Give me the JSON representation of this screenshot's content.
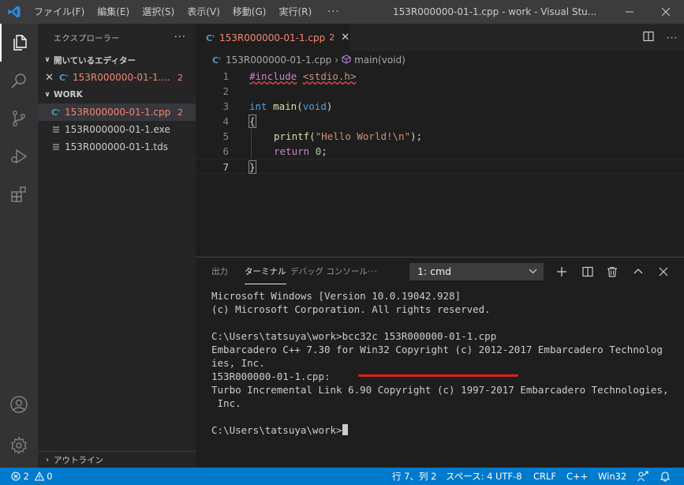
{
  "titlebar": {
    "menu": [
      "ファイル(F)",
      "編集(E)",
      "選択(S)",
      "表示(V)",
      "移動(G)",
      "実行(R)"
    ],
    "more": "···",
    "window_title": "153R000000-01-1.cpp - work - Visual Stu..."
  },
  "sidebar": {
    "title": "エクスプローラー",
    "more": "···",
    "open_editors": {
      "header": "開いているエディター",
      "items": [
        {
          "label": "153R000000-01-1....",
          "badge": "2"
        }
      ]
    },
    "workspace": {
      "header": "WORK",
      "items": [
        {
          "label": "153R000000-01-1.cpp",
          "badge": "2"
        },
        {
          "label": "153R000000-01-1.exe"
        },
        {
          "label": "153R000000-01-1.tds"
        }
      ]
    },
    "outline": "アウトライン"
  },
  "editor": {
    "tab": {
      "label": "153R000000-01-1.cpp",
      "badge": "2"
    },
    "breadcrumb": {
      "file": "153R000000-01-1.cpp",
      "symbol": "main(void)"
    },
    "line_numbers": [
      "1",
      "2",
      "3",
      "4",
      "5",
      "6",
      "7"
    ],
    "code": {
      "l1_directive": "#include",
      "l1_path": "<stdio.h>",
      "l3_type": "int",
      "l3_name": "main",
      "l3_paren_open": "(",
      "l3_param": "void",
      "l3_paren_close": ")",
      "l4": "{",
      "l5_fn": "printf",
      "l5_open": "(",
      "l5_str": "\"Hello World!\\n\"",
      "l5_close": ");",
      "l6_kw": "return",
      "l6_num": "0",
      "l6_end": ";",
      "l7": "}"
    }
  },
  "panel": {
    "tabs": [
      "出力",
      "ターミナル",
      "デバッグ コンソール"
    ],
    "more": "···",
    "terminal_select": "1: cmd",
    "terminal_lines": [
      "Microsoft Windows [Version 10.0.19042.928]",
      "(c) Microsoft Corporation. All rights reserved.",
      "",
      "C:\\Users\\tatsuya\\work>bcc32c 153R000000-01-1.cpp",
      "Embarcadero C++ 7.30 for Win32 Copyright (c) 2012-2017 Embarcadero Technolog",
      "ies, Inc.",
      "153R000000-01-1.cpp:",
      "Turbo Incremental Link 6.90 Copyright (c) 1997-2017 Embarcadero Technologies,",
      " Inc.",
      ""
    ],
    "prompt": "C:\\Users\\tatsuya\\work>"
  },
  "statusbar": {
    "errors": "2",
    "warnings": "0",
    "position": "行 7、列 2",
    "spaces": "スペース: 4",
    "encoding": "UTF-8",
    "eol": "CRLF",
    "language": "C++",
    "platform": "Win32"
  },
  "colors": {
    "accent": "#007acc",
    "error": "#f48771",
    "annotation": "#e0201c"
  }
}
